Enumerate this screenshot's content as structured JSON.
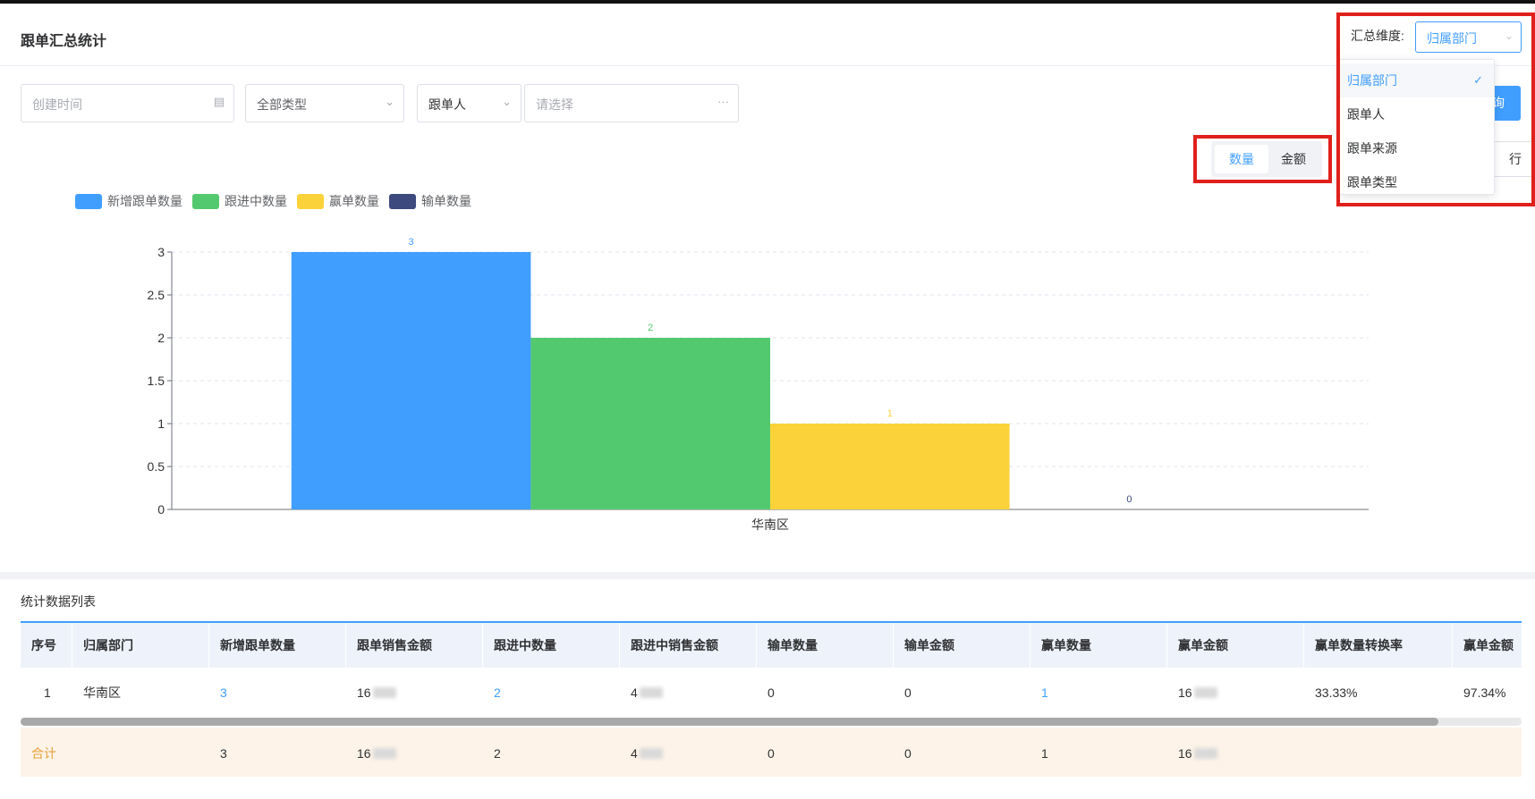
{
  "page": {
    "title": "跟单汇总统计"
  },
  "dimension": {
    "label": "汇总维度:",
    "selected": "归属部门",
    "options": [
      "归属部门",
      "跟单人",
      "跟单来源",
      "跟单类型"
    ]
  },
  "filters": {
    "created_time_placeholder": "创建时间",
    "type_value": "全部类型",
    "person_type": "跟单人",
    "person_placeholder": "请选择"
  },
  "buttons": {
    "query": "询",
    "partial_hidden": "行"
  },
  "toggle": {
    "count": "数量",
    "amount": "金额"
  },
  "colors": {
    "accent": "#409eff",
    "new": "#409eff",
    "following": "#53c96f",
    "won": "#fbd239",
    "lost": "#3c4a7e",
    "highlight_box": "#e0201b"
  },
  "chart_data": {
    "type": "bar",
    "categories": [
      "华南区"
    ],
    "series": [
      {
        "name": "新增跟单数量",
        "values": [
          3
        ]
      },
      {
        "name": "跟进中数量",
        "values": [
          2
        ]
      },
      {
        "name": "赢单数量",
        "values": [
          1
        ]
      },
      {
        "name": "输单数量",
        "values": [
          0
        ]
      }
    ],
    "title": "",
    "xlabel": "",
    "ylabel": "",
    "ylim": [
      0,
      3
    ],
    "yticks": [
      "0",
      "0.5",
      "1",
      "1.5",
      "2",
      "2.5",
      "3"
    ],
    "grid": true,
    "legend_position": "top-left",
    "data_labels": [
      "3",
      "2",
      "1",
      "0"
    ]
  },
  "table": {
    "title": "统计数据列表",
    "columns": [
      "序号",
      "归属部门",
      "新增跟单数量",
      "跟单销售金额",
      "跟进中数量",
      "跟进中销售金额",
      "输单数量",
      "输单金额",
      "赢单数量",
      "赢单金额",
      "赢单数量转换率",
      "赢单金额"
    ],
    "row": {
      "index": "1",
      "dept": "华南区",
      "new_count": "3",
      "sales_amount": "16",
      "following_count": "2",
      "following_amount": "4",
      "lost_count": "0",
      "lost_amount": "0",
      "won_count": "1",
      "won_amount": "16",
      "won_count_rate": "33.33%",
      "won_amount_rate": "97.34%"
    },
    "total": {
      "label": "合计",
      "new_count": "3",
      "sales_amount": "16",
      "following_count": "2",
      "following_amount": "4",
      "lost_count": "0",
      "lost_amount": "0",
      "won_count": "1",
      "won_amount": "16"
    }
  }
}
